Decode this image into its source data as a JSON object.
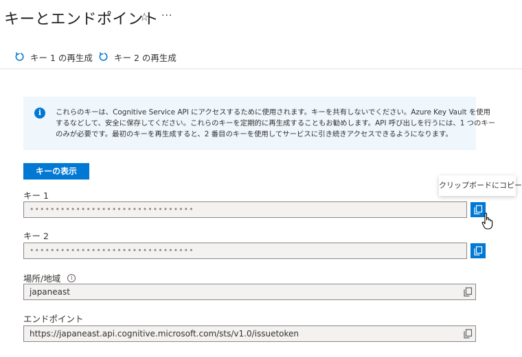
{
  "page": {
    "title": "キーとエンドポイント"
  },
  "header": {
    "star_icon": "star-icon",
    "more_label": "···"
  },
  "commands": [
    {
      "label": "キー 1 の再生成",
      "icon": "refresh-icon"
    },
    {
      "label": "キー 2 の再生成",
      "icon": "refresh-icon"
    }
  ],
  "info": {
    "icon": "info-icon",
    "lines": [
      "これらのキーは、Cognitive Service API にアクセスするために使用されます。キーを共有しないでください。Azure Key Vault を使用",
      "するなどして、安全に保存してください。これらのキーを定期的に再生成することもお勧めします。API 呼び出しを行うには、1 つのキー",
      "のみが必要です。最初のキーを再生成すると、2 番目のキーを使用してサービスに引き続きアクセスできるようになります。"
    ]
  },
  "show_keys_label": "キーの表示",
  "tooltip": "クリップボードにコピー",
  "fields": {
    "key1": {
      "label": "キー 1",
      "value": "••••••••••••••••••••••••••••••••"
    },
    "key2": {
      "label": "キー 2",
      "value": "••••••••••••••••••••••••••••••••"
    },
    "location": {
      "label": "場所/地域",
      "value": "japaneast"
    },
    "endpoint": {
      "label": "エンドポイント",
      "value": "https://japaneast.api.cognitive.microsoft.com/sts/v1.0/issuetoken"
    }
  },
  "colors": {
    "accent": "#0078d4",
    "info_bg": "#eff6fc",
    "field_bg": "#f3f2f1"
  }
}
